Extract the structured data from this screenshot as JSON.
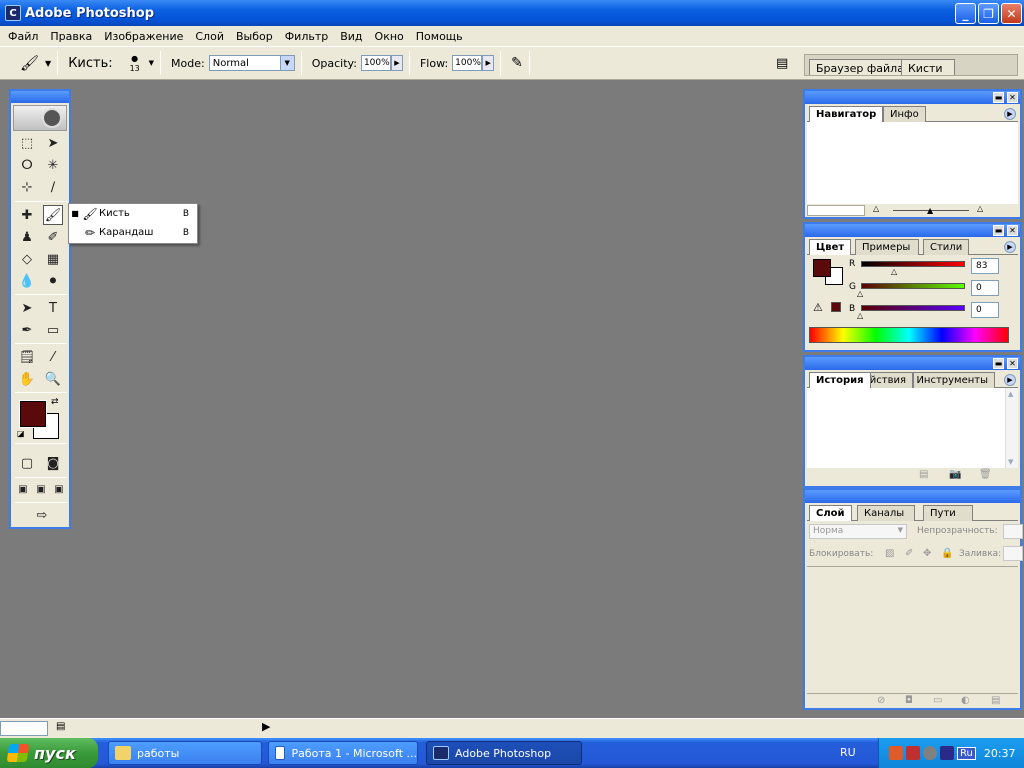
{
  "window": {
    "title": "Adobe Photoshop",
    "minimize": "_",
    "maximize": "❐",
    "close": "✕"
  },
  "menu": [
    "Файл",
    "Правка",
    "Изображение",
    "Слой",
    "Выбор",
    "Фильтр",
    "Вид",
    "Окно",
    "Помощь"
  ],
  "options": {
    "tool_label": "Кисть:",
    "brush_size": "13",
    "mode_label": "Mode:",
    "mode_value": "Normal",
    "opacity_label": "Opacity:",
    "opacity_value": "100%",
    "flow_label": "Flow:",
    "flow_value": "100%"
  },
  "well": {
    "tabs": [
      "Браузер файла",
      "Кисти"
    ]
  },
  "flyout": [
    {
      "label": "Кисть",
      "key": "B",
      "selected": true
    },
    {
      "label": "Карандаш",
      "key": "B",
      "selected": false
    }
  ],
  "colors": {
    "foreground": "#5a0a0a",
    "background": "#ffffff",
    "accent": "#3d7ce8"
  },
  "navigator": {
    "tabs": [
      "Навигатор",
      "Инфо"
    ]
  },
  "color_panel": {
    "tabs": [
      "Цвет",
      "Примеры",
      "Стили"
    ],
    "channels": [
      {
        "name": "R",
        "value": "83"
      },
      {
        "name": "G",
        "value": "0"
      },
      {
        "name": "B",
        "value": "0"
      }
    ]
  },
  "history": {
    "tabs": [
      "История",
      "Действия",
      "Инструменты"
    ]
  },
  "layers": {
    "tabs": [
      "Слой",
      "Каналы",
      "Пути"
    ],
    "blend": "Норма",
    "opacity_label": "Непрозрачность:",
    "lock_label": "Блокировать:",
    "fill_label": "Заливка:"
  },
  "taskbar": {
    "start": "пуск",
    "buttons": [
      "работы",
      "Работа 1 - Microsoft ...",
      "Adobe Photoshop"
    ],
    "lang": "RU",
    "tray_lang": "Ru",
    "time": "20:37"
  }
}
